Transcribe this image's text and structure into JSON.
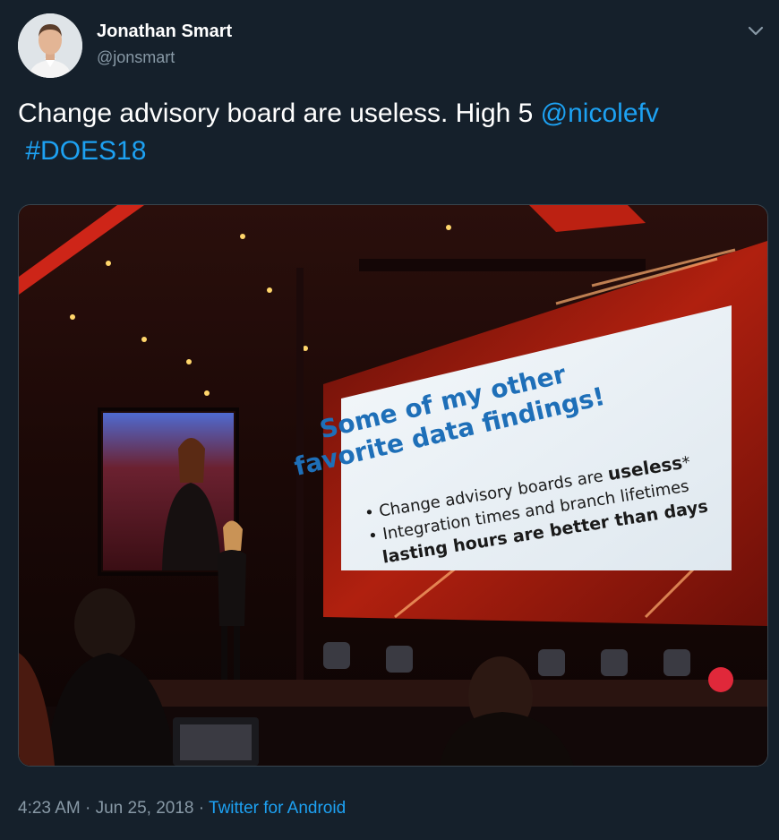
{
  "author": {
    "name": "Jonathan Smart",
    "handle": "@jonsmart"
  },
  "tweet": {
    "text": "Change advisory board are useless. High 5 ",
    "mention": "@nicolefv",
    "hashtag": "#DOES18"
  },
  "photo": {
    "slide_title_line1": "Some of my other",
    "slide_title_line2": "favorite data findings!",
    "bullet1_prefix": "Change advisory boards are ",
    "bullet1_bold": "useless",
    "bullet1_suffix": "*",
    "bullet2_line1": "Integration times and branch lifetimes",
    "bullet2_line2": "lasting hours are better than days"
  },
  "meta": {
    "time": "4:23 AM",
    "separator": " · ",
    "date": "Jun 25, 2018",
    "source": "Twitter for Android"
  },
  "icons": {
    "menu": "chevron-down-icon"
  },
  "colors": {
    "background": "#15202b",
    "link": "#1da1f2",
    "secondary_text": "#8899a6"
  }
}
